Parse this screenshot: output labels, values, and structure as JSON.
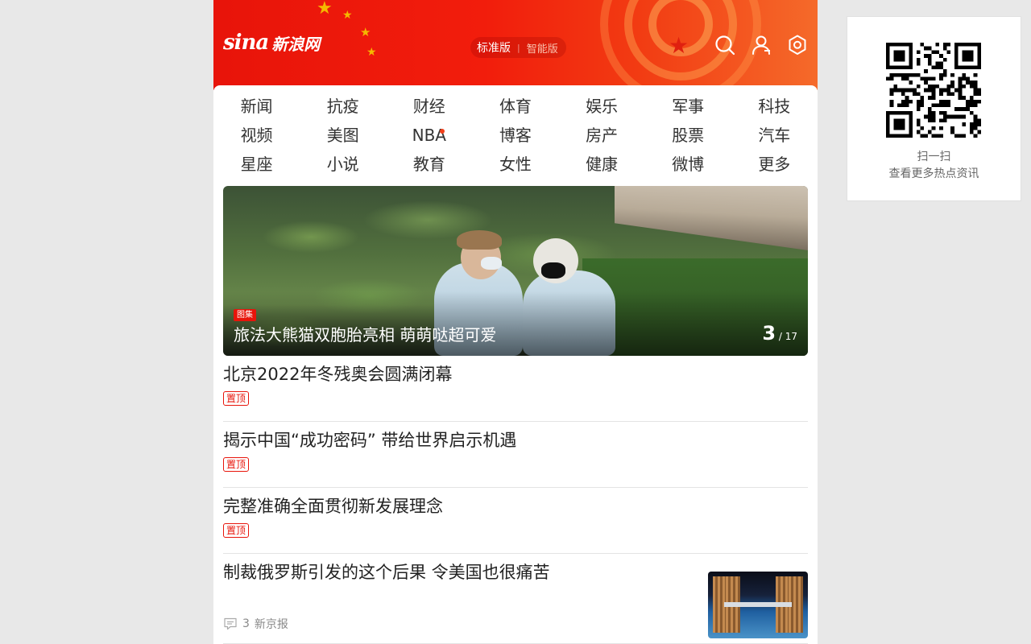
{
  "header": {
    "logo_sina": "sina",
    "logo_cn": "新浪网",
    "version_standard": "标准版",
    "version_smart": "智能版",
    "icons": [
      "search-icon",
      "user-icon",
      "gear-icon"
    ],
    "colors": {
      "brand_red": "#e8140a",
      "accent_orange": "#f56a2a"
    }
  },
  "nav": {
    "rows": [
      [
        "新闻",
        "抗疫",
        "财经",
        "体育",
        "娱乐",
        "军事",
        "科技"
      ],
      [
        "视频",
        "美图",
        "NBA",
        "博客",
        "房产",
        "股票",
        "汽车"
      ],
      [
        "星座",
        "小说",
        "教育",
        "女性",
        "健康",
        "微博",
        "更多"
      ]
    ]
  },
  "hero": {
    "tag": "图集",
    "caption": "旅法大熊猫双胞胎亮相 萌萌哒超可爱",
    "current": "3",
    "total": "/ 17"
  },
  "news": [
    {
      "title": "北京2022年冬残奥会圆满闭幕",
      "badge": "置顶"
    },
    {
      "title": "揭示中国“成功密码” 带给世界启示机遇",
      "badge": "置顶"
    },
    {
      "title": "完整准确全面贯彻新发展理念",
      "badge": "置顶"
    },
    {
      "title": "制裁俄罗斯引发的这个后果 令美国也很痛苦",
      "comments": "3",
      "source": "新京报"
    }
  ],
  "qr_card": {
    "line1": "扫一扫",
    "line2": "查看更多热点资讯"
  }
}
